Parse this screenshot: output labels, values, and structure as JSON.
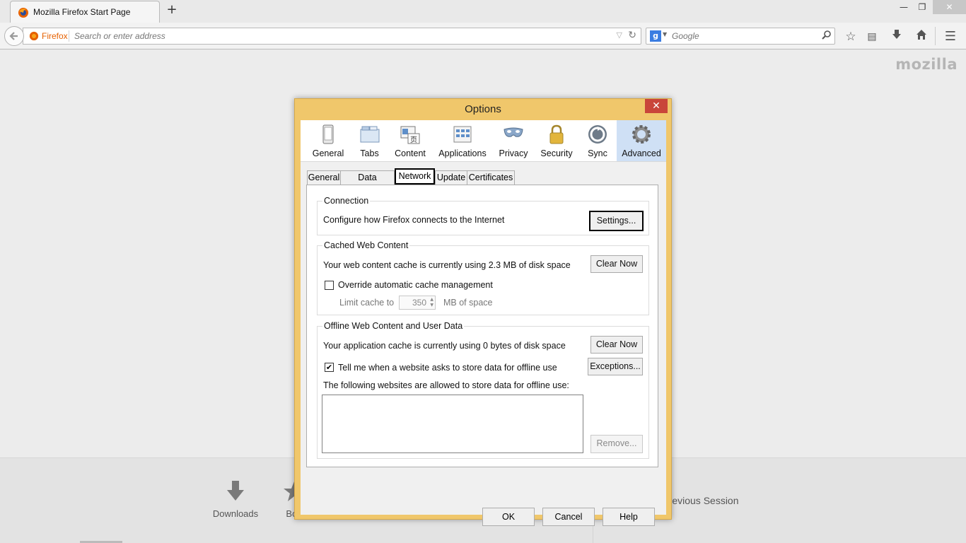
{
  "browser": {
    "tab_title": "Mozilla Firefox Start Page",
    "new_tab": "+",
    "url_identity": "Firefox",
    "url_placeholder": "Search or enter address",
    "search_engine": "g",
    "search_placeholder": "Google",
    "window_controls": {
      "minimize": "—",
      "maximize": "❐",
      "close": "✕"
    }
  },
  "start_page": {
    "brand": "mozilla",
    "launcher": [
      {
        "label": "Downloads",
        "icon": "download-icon"
      },
      {
        "label": "Boo",
        "icon": "bookmarks-icon"
      }
    ],
    "restore_label": "re Previous Session"
  },
  "dialog": {
    "title": "Options",
    "close": "✕",
    "panes": [
      {
        "label": "General",
        "icon": "general-icon"
      },
      {
        "label": "Tabs",
        "icon": "tabs-icon"
      },
      {
        "label": "Content",
        "icon": "content-icon"
      },
      {
        "label": "Applications",
        "icon": "applications-icon"
      },
      {
        "label": "Privacy",
        "icon": "privacy-mask-icon"
      },
      {
        "label": "Security",
        "icon": "lock-icon"
      },
      {
        "label": "Sync",
        "icon": "sync-icon"
      },
      {
        "label": "Advanced",
        "icon": "gear-icon",
        "active": true
      }
    ],
    "subtabs": [
      {
        "label": "General"
      },
      {
        "label": "Data Choices"
      },
      {
        "label": "Network",
        "active": true
      },
      {
        "label": "Update"
      },
      {
        "label": "Certificates"
      }
    ],
    "connection": {
      "legend": "Connection",
      "description": "Configure how Firefox connects to the Internet",
      "settings_button": "Settings..."
    },
    "cache": {
      "legend": "Cached Web Content",
      "description": "Your web content cache is currently using 2.3 MB of disk space",
      "clear_button": "Clear Now",
      "override_label": "Override automatic cache management",
      "override_checked": false,
      "limit_label": "Limit cache to",
      "limit_value": "350",
      "limit_unit": "MB of space"
    },
    "offline": {
      "legend": "Offline Web Content and User Data",
      "description": "Your application cache is currently using 0 bytes of disk space",
      "clear_button": "Clear Now",
      "tell_me_label": "Tell me when a website asks to store data for offline use",
      "tell_me_checked": true,
      "exceptions_button": "Exceptions...",
      "list_label": "The following websites are allowed to store data for offline use:",
      "remove_button": "Remove..."
    },
    "footer": {
      "ok": "OK",
      "cancel": "Cancel",
      "help": "Help"
    }
  }
}
